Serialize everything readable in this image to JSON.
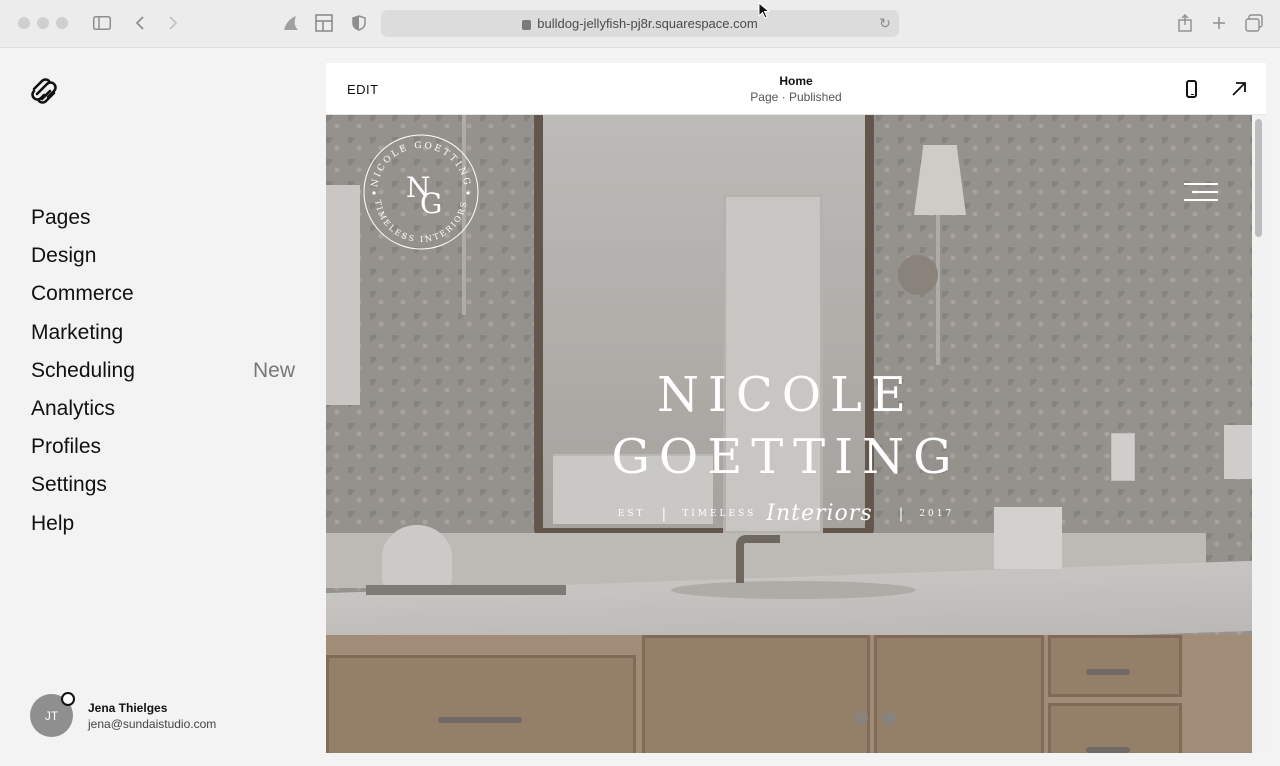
{
  "browser": {
    "url": "bulldog-jellyfish-pj8r.squarespace.com"
  },
  "sidebar": {
    "items": [
      {
        "label": "Pages",
        "badge": ""
      },
      {
        "label": "Design",
        "badge": ""
      },
      {
        "label": "Commerce",
        "badge": ""
      },
      {
        "label": "Marketing",
        "badge": ""
      },
      {
        "label": "Scheduling",
        "badge": "New"
      },
      {
        "label": "Analytics",
        "badge": ""
      },
      {
        "label": "Profiles",
        "badge": ""
      },
      {
        "label": "Settings",
        "badge": ""
      },
      {
        "label": "Help",
        "badge": ""
      }
    ],
    "user": {
      "initials": "JT",
      "name": "Jena Thielges",
      "email": "jena@sundaistudio.com"
    }
  },
  "preview": {
    "edit_label": "EDIT",
    "page_name": "Home",
    "page_status": "Page · Published"
  },
  "hero": {
    "seal_top": "NICOLE GOETTING",
    "seal_bottom": "TIMELESS INTERIORS",
    "monogram_1": "N",
    "monogram_2": "G",
    "brand_line_1": "NICOLE",
    "brand_line_2": "GOETTING",
    "tag_est": "EST",
    "tag_timeless": "TIMELESS",
    "tag_script": "Interiors",
    "tag_year": "2017"
  },
  "colors": {
    "accent": "#111111",
    "sidebar_bg": "#f3f3f3",
    "badge": "#777777"
  }
}
